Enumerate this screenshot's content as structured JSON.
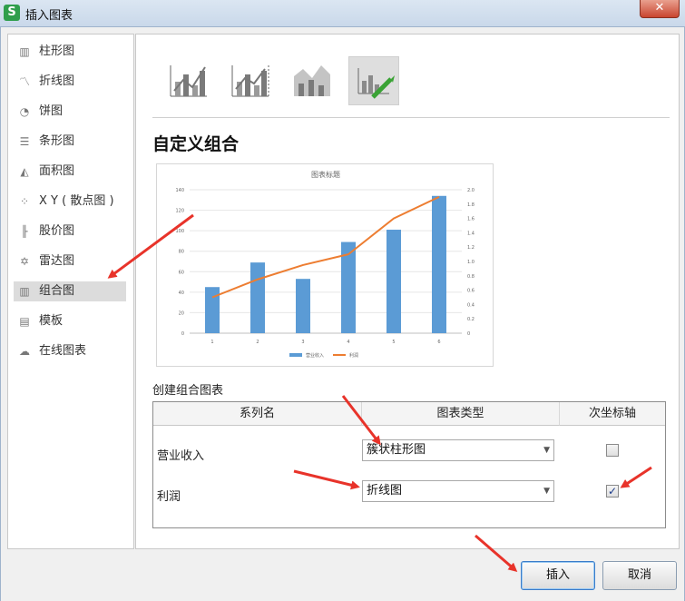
{
  "window": {
    "title": "插入图表",
    "app_icon_letter": "S",
    "close_glyph": "✕"
  },
  "sidebar": {
    "items": [
      {
        "label": "柱形图",
        "icon": "column-chart-icon",
        "glyph": "▥"
      },
      {
        "label": "折线图",
        "icon": "line-chart-icon",
        "glyph": "〽"
      },
      {
        "label": "饼图",
        "icon": "pie-chart-icon",
        "glyph": "◔"
      },
      {
        "label": "条形图",
        "icon": "bar-chart-icon",
        "glyph": "☰"
      },
      {
        "label": "面积图",
        "icon": "area-chart-icon",
        "glyph": "◭"
      },
      {
        "label": "X Y ( 散点图 )",
        "icon": "scatter-chart-icon",
        "glyph": "⁘"
      },
      {
        "label": "股价图",
        "icon": "stock-chart-icon",
        "glyph": "╟"
      },
      {
        "label": "雷达图",
        "icon": "radar-chart-icon",
        "glyph": "✡"
      },
      {
        "label": "组合图",
        "icon": "combo-chart-icon",
        "glyph": "▥",
        "selected": true
      },
      {
        "label": "模板",
        "icon": "template-icon",
        "glyph": "▤"
      },
      {
        "label": "在线图表",
        "icon": "online-chart-icon",
        "glyph": "☁"
      }
    ]
  },
  "main": {
    "section_title": "自定义组合",
    "build_label": "创建组合图表",
    "table": {
      "headers": [
        "系列名",
        "图表类型",
        "次坐标轴"
      ],
      "rows": [
        {
          "name": "营业收入",
          "type": "簇状柱形图",
          "secondary_axis": false
        },
        {
          "name": "利润",
          "type": "折线图",
          "secondary_axis": true
        }
      ],
      "caret_glyph": "▼",
      "check_glyph": "✓"
    }
  },
  "buttons": {
    "insert": "插入",
    "cancel": "取消"
  },
  "colors": {
    "bar": "#5b9bd5",
    "line": "#ed7d31",
    "selected_bg": "#dcdcdc",
    "arrow": "#e8332a"
  },
  "chart_data": {
    "type": "bar",
    "title": "图表标题",
    "categories": [
      "1",
      "2",
      "3",
      "4",
      "5",
      "6"
    ],
    "series": [
      {
        "name": "营业收入",
        "type": "bar",
        "axis": "primary",
        "values": [
          45,
          69,
          53,
          89,
          101,
          134
        ]
      },
      {
        "name": "利润",
        "type": "line",
        "axis": "secondary",
        "values": [
          0.5,
          0.75,
          0.95,
          1.1,
          1.6,
          1.9
        ]
      }
    ],
    "y_primary": {
      "min": 0,
      "max": 140,
      "ticks": [
        0,
        20,
        40,
        60,
        80,
        100,
        120,
        140
      ]
    },
    "y_secondary": {
      "min": 0,
      "max": 2.0,
      "ticks": [
        "0",
        "0.2",
        "0.4",
        "0.6",
        "0.8",
        "1.0",
        "1.2",
        "1.4",
        "1.6",
        "1.8",
        "2.0"
      ]
    },
    "grid": true,
    "legend": "bottom"
  }
}
